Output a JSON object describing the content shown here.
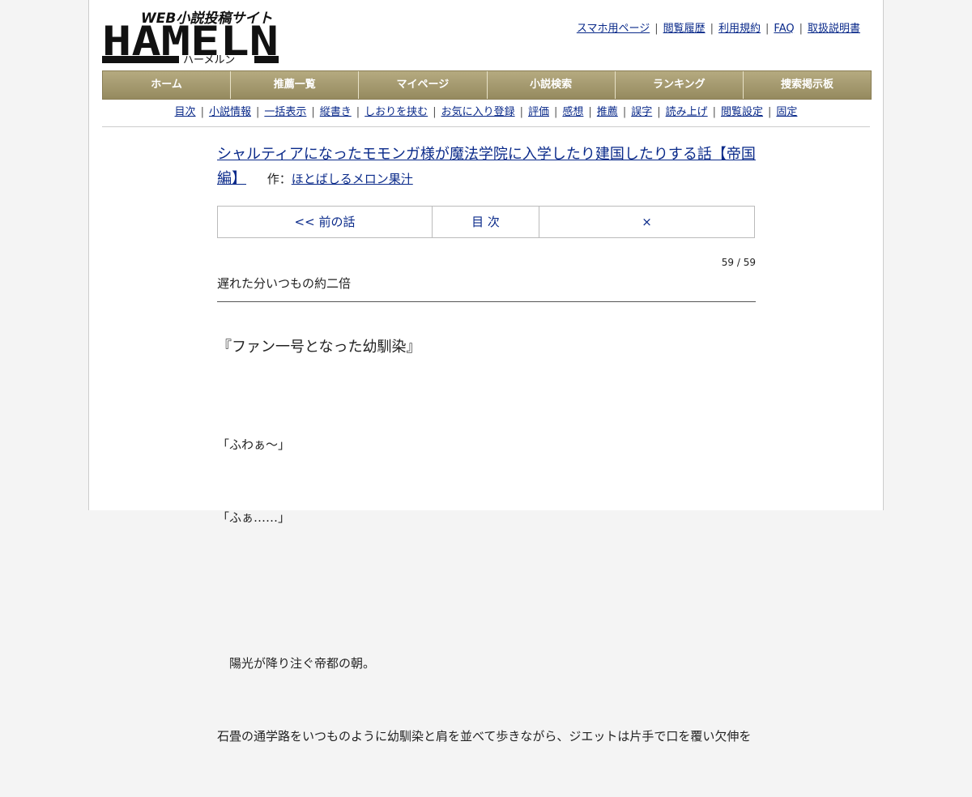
{
  "logo": {
    "tagline": "WEB小説投稿サイト",
    "name": "HAMELN",
    "kana": "ハーメルン"
  },
  "top_links": [
    "スマホ用ページ",
    "閲覧履歴",
    "利用規約",
    "FAQ",
    "取扱説明書"
  ],
  "main_nav": [
    "ホーム",
    "推薦一覧",
    "マイページ",
    "小説検索",
    "ランキング",
    "捜索掲示板"
  ],
  "sub_nav": [
    "目次",
    "小説情報",
    "一括表示",
    "縦書き",
    "しおりを挟む",
    "お気に入り登録",
    "評価",
    "感想",
    "推薦",
    "誤字",
    "読み上げ",
    "閲覧設定",
    "固定"
  ],
  "novel": {
    "title": "シャルティアになったモモンガ様が魔法学院に入学したり建国したりする話【帝国編】",
    "author_prefix": "作：",
    "author": "ほとばしるメロン果汁"
  },
  "chapter_nav": {
    "prev": "<< 前の話",
    "toc": "目 次",
    "close": "×"
  },
  "progress": "59 / 59",
  "chapter_subtitle": "遅れた分いつもの約二倍",
  "chapter_heading": "『ファン一号となった幼馴染』",
  "body": {
    "line1": "「ふわぁ～」",
    "line2": "「ふぁ……」",
    "line3": "　陽光が降り注ぐ帝都の朝。",
    "line4": "石畳の通学路をいつものように幼馴染と肩を並べて歩きながら、ジエットは片手で口を覆い欠伸を"
  }
}
